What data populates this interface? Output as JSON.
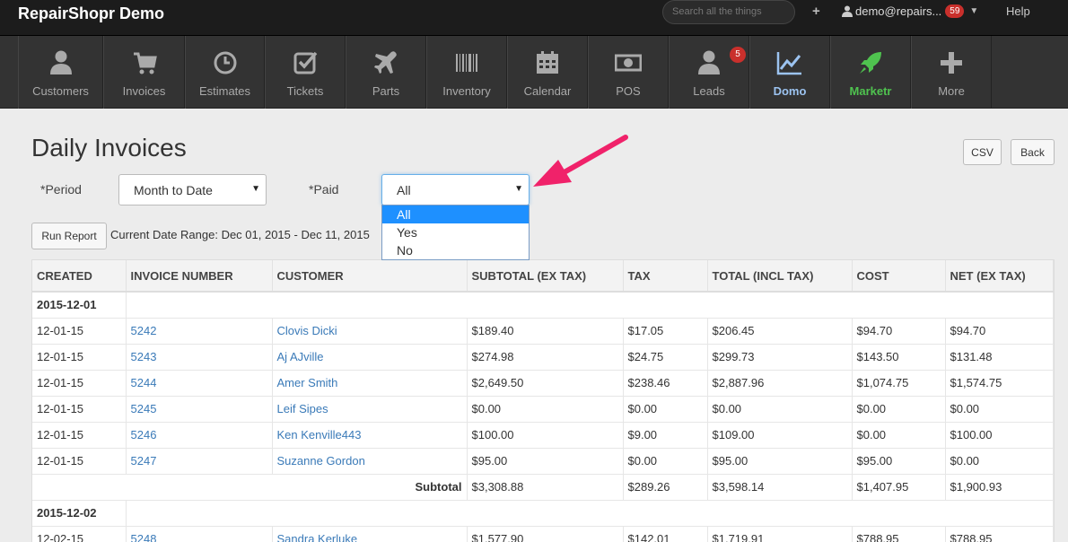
{
  "topbar": {
    "brand": "RepairShopr Demo",
    "search_placeholder": "Search all the things",
    "plus": "+",
    "user": "demo@repairs...",
    "notif_count": "59",
    "help": "Help"
  },
  "nav": {
    "items": [
      {
        "label": "Customers",
        "icon": "user-icon"
      },
      {
        "label": "Invoices",
        "icon": "cart-icon"
      },
      {
        "label": "Estimates",
        "icon": "clock-icon"
      },
      {
        "label": "Tickets",
        "icon": "checkbox-icon"
      },
      {
        "label": "Parts",
        "icon": "plane-icon"
      },
      {
        "label": "Inventory",
        "icon": "barcode-icon"
      },
      {
        "label": "Calendar",
        "icon": "calendar-icon"
      },
      {
        "label": "POS",
        "icon": "money-icon"
      },
      {
        "label": "Leads",
        "icon": "user-icon",
        "badge": "5"
      },
      {
        "label": "Domo",
        "icon": "chart-line-icon"
      },
      {
        "label": "Marketr",
        "icon": "rocket-icon"
      },
      {
        "label": "More",
        "icon": "plus-icon"
      }
    ]
  },
  "page": {
    "title": "Daily Invoices",
    "csv_label": "CSV",
    "back_label": "Back",
    "period_label": "*Period",
    "period_value": "Month to Date",
    "paid_label": "*Paid",
    "paid_value": "All",
    "paid_options": [
      "All",
      "Yes",
      "No"
    ],
    "run_report_label": "Run Report",
    "date_range": "Current Date Range: Dec 01, 2015 - Dec 11, 2015"
  },
  "table": {
    "headers": [
      "CREATED",
      "INVOICE NUMBER",
      "CUSTOMER",
      "SUBTOTAL (EX TAX)",
      "TAX",
      "TOTAL (INCL TAX)",
      "COST",
      "NET (EX TAX)"
    ],
    "group1": {
      "date": "2015-12-01",
      "rows": [
        [
          "12-01-15",
          "5242",
          "Clovis Dicki",
          "$189.40",
          "$17.05",
          "$206.45",
          "$94.70",
          "$94.70"
        ],
        [
          "12-01-15",
          "5243",
          "Aj AJville",
          "$274.98",
          "$24.75",
          "$299.73",
          "$143.50",
          "$131.48"
        ],
        [
          "12-01-15",
          "5244",
          "Amer Smith",
          "$2,649.50",
          "$238.46",
          "$2,887.96",
          "$1,074.75",
          "$1,574.75"
        ],
        [
          "12-01-15",
          "5245",
          "Leif Sipes",
          "$0.00",
          "$0.00",
          "$0.00",
          "$0.00",
          "$0.00"
        ],
        [
          "12-01-15",
          "5246",
          "Ken Kenville443",
          "$100.00",
          "$9.00",
          "$109.00",
          "$0.00",
          "$100.00"
        ],
        [
          "12-01-15",
          "5247",
          "Suzanne Gordon",
          "$95.00",
          "$0.00",
          "$95.00",
          "$95.00",
          "$0.00"
        ]
      ],
      "subtotal": [
        "Subtotal",
        "$3,308.88",
        "$289.26",
        "$3,598.14",
        "$1,407.95",
        "$1,900.93"
      ]
    },
    "group2": {
      "date": "2015-12-02",
      "rows": [
        [
          "12-02-15",
          "5248",
          "Sandra Kerluke",
          "$1,577.90",
          "$142.01",
          "$1,719.91",
          "$788.95",
          "$788.95"
        ]
      ]
    }
  }
}
